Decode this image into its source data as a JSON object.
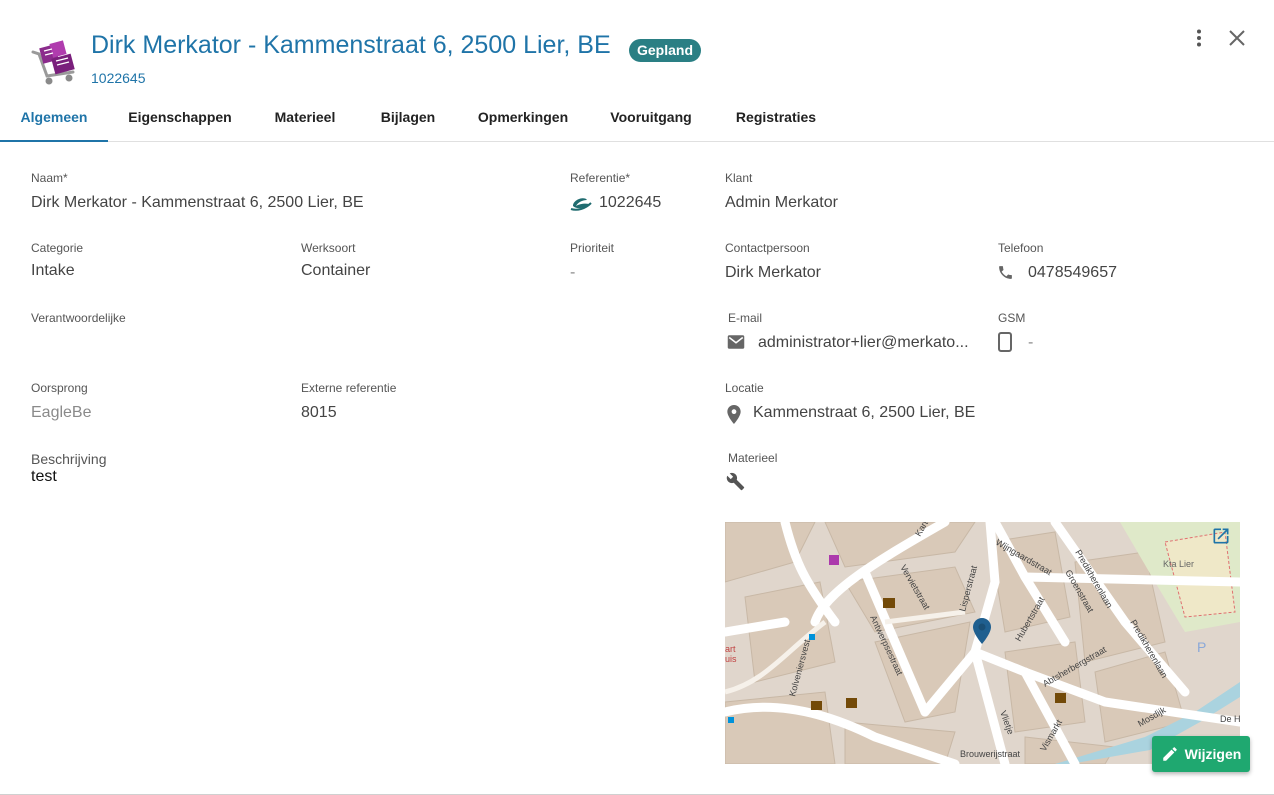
{
  "header": {
    "title": "Dirk Merkator - Kammenstraat 6, 2500 Lier, BE",
    "status_badge": "Gepland",
    "reference": "1022645",
    "logo_icon": "cart-boxes-icon",
    "menu_icon": "more-vertical-icon",
    "close_icon": "close-icon"
  },
  "tabs": [
    {
      "label": "Algemeen",
      "active": true
    },
    {
      "label": "Eigenschappen"
    },
    {
      "label": "Materieel"
    },
    {
      "label": "Bijlagen"
    },
    {
      "label": "Opmerkingen"
    },
    {
      "label": "Vooruitgang"
    },
    {
      "label": "Registraties"
    }
  ],
  "fields": {
    "naam": {
      "label": "Naam*",
      "value": "Dirk Merkator - Kammenstraat 6, 2500 Lier, BE"
    },
    "referentie": {
      "label": "Referentie*",
      "value": "1022645",
      "icon": "eagle-logo-icon"
    },
    "klant": {
      "label": "Klant",
      "value": "Admin Merkator"
    },
    "categorie": {
      "label": "Categorie",
      "value": "Intake"
    },
    "werksoort": {
      "label": "Werksoort",
      "value": "Container"
    },
    "prioriteit": {
      "label": "Prioriteit",
      "value": "-"
    },
    "contactpersoon": {
      "label": "Contactpersoon",
      "value": "Dirk Merkator"
    },
    "telefoon": {
      "label": "Telefoon",
      "value": "0478549657",
      "icon": "phone-icon"
    },
    "verantwoordelijke": {
      "label": "Verantwoordelijke",
      "value": ""
    },
    "email": {
      "label": "E-mail",
      "value": "administrator+lier@merkato...",
      "icon": "email-icon"
    },
    "gsm": {
      "label": "GSM",
      "value": "-",
      "icon": "mobile-phone-icon"
    },
    "oorsprong": {
      "label": "Oorsprong",
      "value": "EagleBe"
    },
    "externe_referentie": {
      "label": "Externe referentie",
      "value": "8015"
    },
    "locatie": {
      "label": "Locatie",
      "value": "Kammenstraat 6, 2500 Lier, BE",
      "icon": "location-pin-icon"
    },
    "beschrijving": {
      "label": "Beschrijving",
      "value": "test"
    },
    "materieel": {
      "label": "Materieel",
      "icon": "wrench-icon"
    }
  },
  "map": {
    "street_labels": [
      "Wijngaardstraat",
      "Vervietstraat",
      "Lisperstraat",
      "Antwerpsestraat",
      "Kolveniersvest",
      "Predikherenlaan",
      "Groenstraat",
      "Hubertstraat",
      "Abtsherbergstraat",
      "Vismarkt",
      "Brouwerijstraat",
      "Mosdijk",
      "Vlietje",
      "Kartuizersvest",
      "De H",
      "Kta Lier"
    ],
    "open_external_icon": "open-in-new-icon",
    "marker_icon": "map-marker-icon"
  },
  "actions": {
    "edit_label": "Wijzigen",
    "edit_icon": "pencil-icon"
  },
  "colors": {
    "primary": "#1f74a8",
    "badge": "#2a7f84",
    "fab": "#1fa870"
  }
}
